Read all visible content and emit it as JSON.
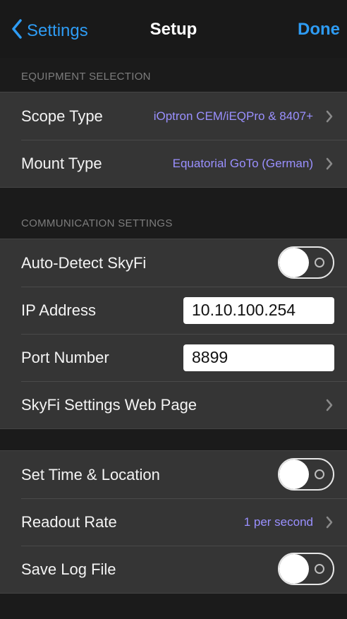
{
  "nav": {
    "back_label": "Settings",
    "title": "Setup",
    "done_label": "Done"
  },
  "colors": {
    "accent": "#2e9cf4",
    "value_text": "#9a90ff",
    "group_bg": "#353535",
    "page_bg": "#1b1b1b"
  },
  "equipment": {
    "header": "EQUIPMENT SELECTION",
    "scope_type": {
      "label": "Scope Type",
      "value": "iOptron CEM/iEQPro & 8407+"
    },
    "mount_type": {
      "label": "Mount Type",
      "value": "Equatorial GoTo (German)"
    }
  },
  "communication": {
    "header": "COMMUNICATION SETTINGS",
    "auto_detect": {
      "label": "Auto-Detect SkyFi",
      "on": false
    },
    "ip_address": {
      "label": "IP Address",
      "value": "10.10.100.254"
    },
    "port_number": {
      "label": "Port Number",
      "value": "8899"
    },
    "web_page": {
      "label": "SkyFi Settings Web Page"
    }
  },
  "misc": {
    "set_time": {
      "label": "Set Time & Location",
      "on": false
    },
    "readout_rate": {
      "label": "Readout Rate",
      "value": "1 per second"
    },
    "save_log": {
      "label": "Save Log File",
      "on": false
    }
  }
}
